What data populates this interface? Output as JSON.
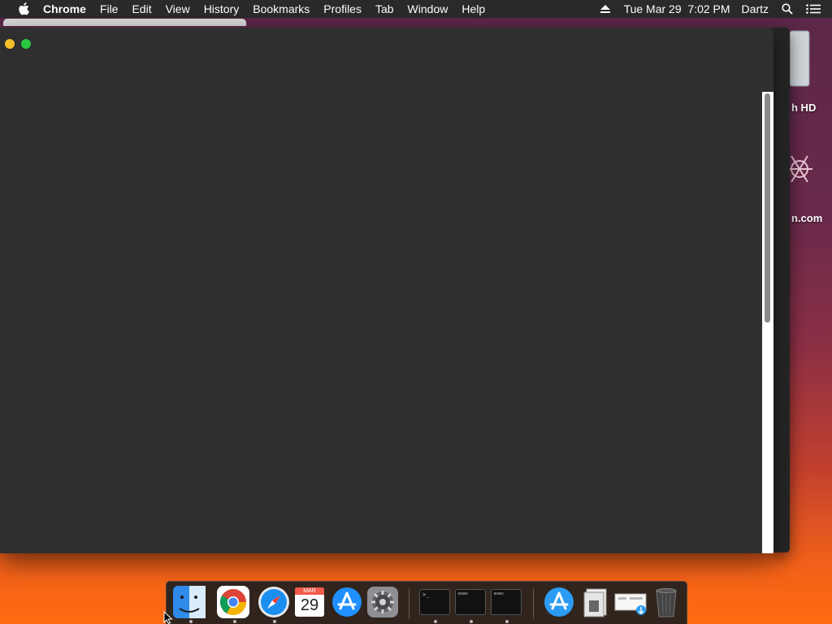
{
  "menubar": {
    "app_name": "Chrome",
    "menus": [
      "File",
      "Edit",
      "View",
      "History",
      "Bookmarks",
      "Profiles",
      "Tab",
      "Window",
      "Help"
    ],
    "datetime": "Tue Mar 29  7:02 PM",
    "user": "Dartz"
  },
  "desktop": {
    "icons": [
      {
        "label": "h HD",
        "icon": "hard-drive-icon"
      },
      {
        "label": "n.com",
        "icon": "package-icon"
      }
    ]
  },
  "window": {
    "buttons": [
      "minimize",
      "zoom"
    ],
    "scroll_position": 0.0
  },
  "dock": {
    "calendar_month": "MAR",
    "calendar_day": "29",
    "terminal_prompt": ">_",
    "exec_label": "exec",
    "items": [
      {
        "name": "finder-icon",
        "running": true
      },
      {
        "name": "chrome-icon",
        "running": true
      },
      {
        "name": "safari-icon",
        "running": true
      },
      {
        "name": "calendar-icon",
        "running": false
      },
      {
        "name": "app-store-icon",
        "running": false
      },
      {
        "name": "system-preferences-icon",
        "running": false
      },
      {
        "name": "terminal-icon",
        "running": true
      },
      {
        "name": "exec-terminal-icon",
        "running": true
      },
      {
        "name": "exec-terminal-icon-2",
        "running": true
      },
      {
        "name": "applications-folder-icon",
        "running": false
      },
      {
        "name": "documents-stack-icon",
        "running": false
      },
      {
        "name": "downloads-stack-icon",
        "running": false
      },
      {
        "name": "trash-icon",
        "running": false
      }
    ]
  },
  "colors": {
    "menubar_bg": "#2a2a2c",
    "window_bg": "#2f2f2f",
    "traffic_yellow": "#f5bf2b",
    "traffic_green": "#28c840"
  }
}
